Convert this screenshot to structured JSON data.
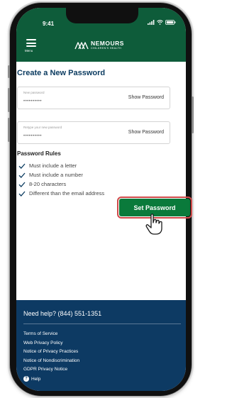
{
  "status_bar": {
    "time": "9:41"
  },
  "header": {
    "menu_label": "Menu",
    "logo_name": "NEMOURS",
    "logo_sub": "CHILDREN'S HEALTH"
  },
  "page": {
    "title": "Create a New Password",
    "fields": [
      {
        "label": "New password",
        "value": "••••••••••",
        "action": "Show Password"
      },
      {
        "label": "Retype your new password",
        "value": "••••••••••",
        "action": "Show Password"
      }
    ],
    "rules_title": "Password Rules",
    "rules": [
      "Must include a letter",
      "Must include a number",
      "8-20 characters",
      "Different than the email address"
    ],
    "submit_label": "Set Password"
  },
  "footer": {
    "help_text": "Need help? (844) 551-1351",
    "links": [
      "Terms of Service",
      "Web Privacy Policy",
      "Notice of Privacy Practices",
      "Notice of Nondiscrimination",
      "GDPR Privacy Notice"
    ],
    "help_label": "Help"
  },
  "colors": {
    "header_green": "#0e5c3a",
    "button_green": "#0a7a3b",
    "title_blue": "#0b3b60",
    "footer_navy": "#0d3a63",
    "highlight_red": "#d04a4a"
  }
}
